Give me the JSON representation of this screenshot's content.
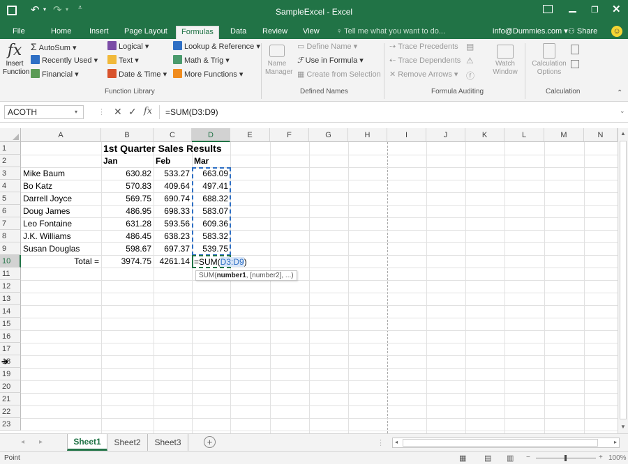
{
  "title_bar": {
    "file_title": "SampleExcel - Excel"
  },
  "tabs": [
    "File",
    "Home",
    "Insert",
    "Page Layout",
    "Formulas",
    "Data",
    "Review",
    "View"
  ],
  "tell_me": "Tell me what you want to do...",
  "account": "info@Dummies.com",
  "share": "Share",
  "ribbon": {
    "insert_function": {
      "symbol": "fx",
      "label_line1": "Insert",
      "label_line2": "Function"
    },
    "function_library": {
      "autosum": "AutoSum",
      "recently_used": "Recently Used",
      "financial": "Financial",
      "logical": "Logical",
      "text": "Text",
      "date_time": "Date & Time",
      "lookup_reference": "Lookup & Reference",
      "math_trig": "Math & Trig",
      "more_functions": "More Functions",
      "group_label": "Function Library"
    },
    "defined_names": {
      "name_manager_line1": "Name",
      "name_manager_line2": "Manager",
      "define_name": "Define Name",
      "use_in_formula": "Use in Formula",
      "create_from_selection": "Create from Selection",
      "group_label": "Defined Names"
    },
    "formula_auditing": {
      "trace_precedents": "Trace Precedents",
      "trace_dependents": "Trace Dependents",
      "remove_arrows": "Remove Arrows",
      "watch_line1": "Watch",
      "watch_line2": "Window",
      "group_label": "Formula Auditing"
    },
    "calculation": {
      "options_line1": "Calculation",
      "options_line2": "Options",
      "group_label": "Calculation"
    }
  },
  "formula_bar": {
    "name_box": "ACOTH",
    "fx_symbol": "fx",
    "formula": "=SUM(D3:D9)"
  },
  "columns": [
    "A",
    "B",
    "C",
    "D",
    "E",
    "F",
    "G",
    "H",
    "I",
    "J",
    "K",
    "L",
    "M",
    "N"
  ],
  "rows": [
    "1",
    "2",
    "3",
    "4",
    "5",
    "6",
    "7",
    "8",
    "9",
    "10",
    "11",
    "12",
    "13",
    "14",
    "15",
    "16",
    "17",
    "18",
    "19",
    "20",
    "21",
    "22",
    "23"
  ],
  "sheet": {
    "title": "1st Quarter Sales Results",
    "headers": [
      "Jan",
      "Feb",
      "Mar"
    ],
    "data": [
      {
        "name": "Mike Baum",
        "jan": "630.82",
        "feb": "533.27",
        "mar": "663.09"
      },
      {
        "name": "Bo Katz",
        "jan": "570.83",
        "feb": "409.64",
        "mar": "497.41"
      },
      {
        "name": "Darrell Joyce",
        "jan": "569.75",
        "feb": "690.74",
        "mar": "688.32"
      },
      {
        "name": "Doug James",
        "jan": "486.95",
        "feb": "698.33",
        "mar": "583.07"
      },
      {
        "name": "Leo Fontaine",
        "jan": "631.28",
        "feb": "593.56",
        "mar": "609.36"
      },
      {
        "name": "J.K. Williams",
        "jan": "486.45",
        "feb": "638.23",
        "mar": "583.32"
      },
      {
        "name": "Susan Douglas",
        "jan": "598.67",
        "feb": "697.37",
        "mar": "539.75"
      }
    ],
    "total_label": "Total =",
    "total_jan": "3974.75",
    "total_feb": "4261.14",
    "edit_prefix": "=SUM(",
    "edit_ref": "D3:D9",
    "edit_suffix": ")",
    "tooltip_prefix": "SUM(",
    "tooltip_bold": "number1",
    "tooltip_rest": ", [number2], ...)"
  },
  "sheet_tabs": [
    "Sheet1",
    "Sheet2",
    "Sheet3"
  ],
  "status": {
    "mode": "Point",
    "zoom": "100%"
  },
  "colors": {
    "excel_green": "#217346",
    "ref_blue": "#2e6fc4",
    "marquee_green": "#217346"
  }
}
